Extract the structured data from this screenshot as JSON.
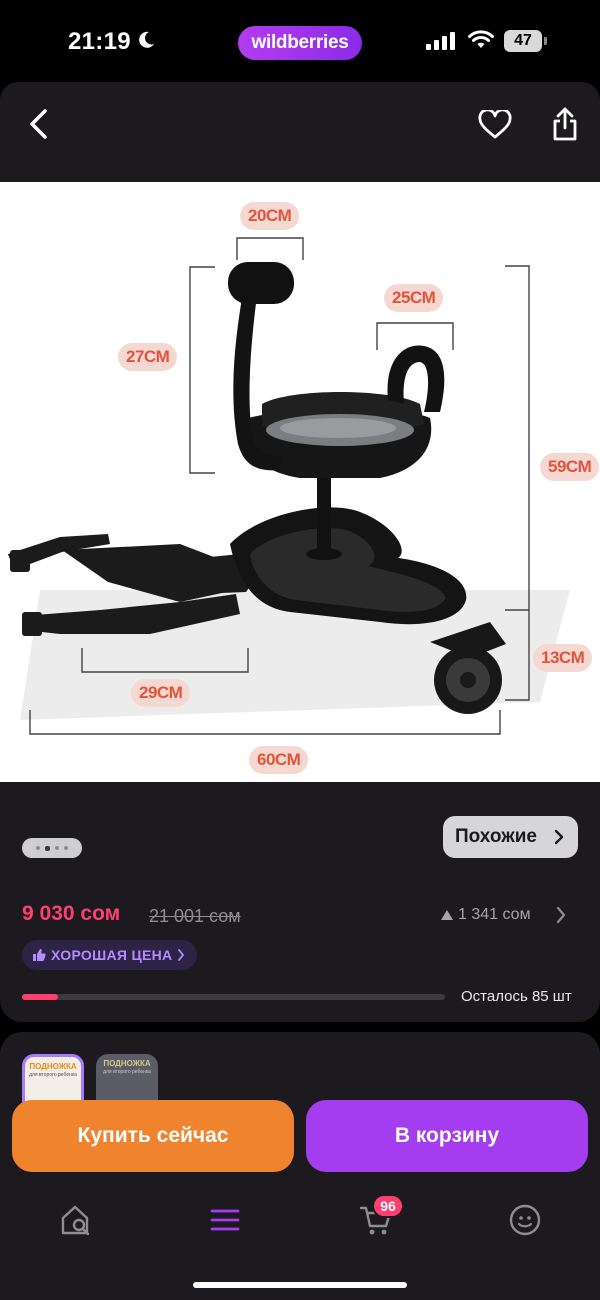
{
  "status_bar": {
    "time": "21:19",
    "brand": "wildberries",
    "battery": "47"
  },
  "nav": {
    "back_icon": "chevron-left-icon",
    "favorite_icon": "heart-icon",
    "share_icon": "share-icon"
  },
  "product_image": {
    "dimensions": {
      "handle_width": "20CM",
      "seat_width": "25CM",
      "handle_height": "27CM",
      "total_height": "59CM",
      "wheel_height": "13CM",
      "connector_length": "29CM",
      "total_length": "60CM"
    }
  },
  "gallery": {
    "dots_count": 4,
    "active_dot": 1
  },
  "similar_button": "Похожие",
  "price": {
    "current": "9 030 сом",
    "old": "21 001 сом",
    "rating_count": "1 341 сом",
    "good_price_label": "ХОРОШАЯ ЦЕНА",
    "stock_label": "Осталось 85 шт",
    "stock_fraction": 0.085
  },
  "variants": {
    "thumb_1_text": "ПОДНОЖКА",
    "thumb_1_subtext": "для второго ребенка",
    "thumb_2_text": "ПОДНОЖКА",
    "thumb_2_subtext": "для второго ребенка"
  },
  "actions": {
    "buy_now": "Купить сейчас",
    "add_to_cart": "В корзину"
  },
  "tab_bar": {
    "cart_badge": "96"
  },
  "colors": {
    "accent_purple": "#a43cf0",
    "accent_orange": "#f0832e",
    "price_red": "#ff3f6f",
    "panel_bg": "#1c1a1e"
  }
}
